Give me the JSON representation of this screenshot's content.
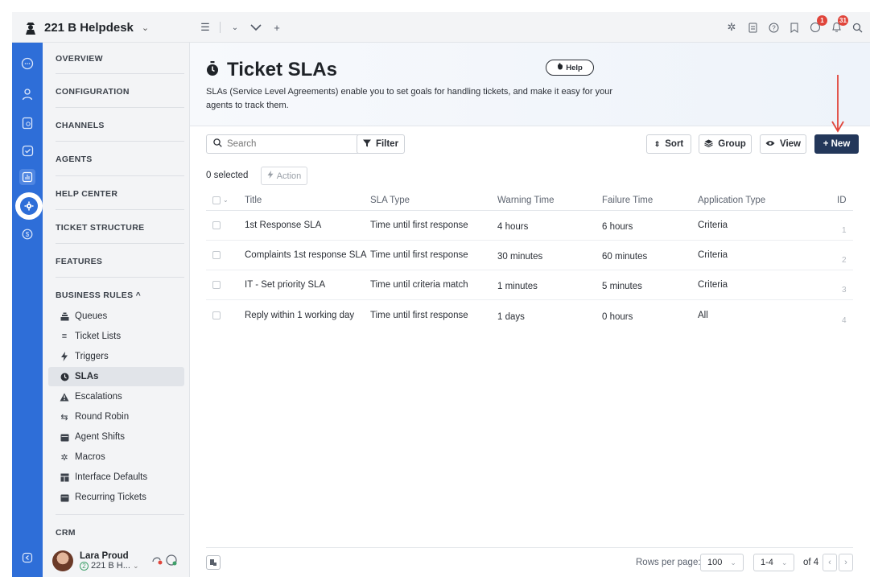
{
  "topbar": {
    "brand_name": "221 B Helpdesk",
    "badges": {
      "notifications_1": "1",
      "notifications_2": "31"
    }
  },
  "sidebar": {
    "sections": [
      "OVERVIEW",
      "CONFIGURATION",
      "CHANNELS",
      "AGENTS",
      "HELP CENTER",
      "TICKET STRUCTURE",
      "FEATURES"
    ],
    "business_rules_label": "BUSINESS RULES ^",
    "business_rules_items": [
      {
        "label": "Queues",
        "icon": "queues-icon"
      },
      {
        "label": "Ticket Lists",
        "icon": "list-icon"
      },
      {
        "label": "Triggers",
        "icon": "bolt-icon"
      },
      {
        "label": "SLAs",
        "icon": "clock-icon"
      },
      {
        "label": "Escalations",
        "icon": "warning-icon"
      },
      {
        "label": "Round Robin",
        "icon": "round-robin-icon"
      },
      {
        "label": "Agent Shifts",
        "icon": "calendar-icon"
      },
      {
        "label": "Macros",
        "icon": "sparkle-icon"
      },
      {
        "label": "Interface Defaults",
        "icon": "interface-icon"
      },
      {
        "label": "Recurring Tickets",
        "icon": "calendar-icon"
      }
    ],
    "crm_label": "CRM",
    "user": {
      "name": "Lara Proud",
      "org_count": "2",
      "org": "221 B H..."
    }
  },
  "page": {
    "title": "Ticket SLAs",
    "help_label": "Help",
    "description": "SLAs (Service Level Agreements) enable you to set goals for handling tickets, and make it easy for your agents to track them."
  },
  "toolbar": {
    "search_placeholder": "Search",
    "filter_label": "Filter",
    "sort_label": "Sort",
    "group_label": "Group",
    "view_label": "View",
    "new_label": "+ New",
    "selected_label": "0 selected",
    "action_label": "Action"
  },
  "table": {
    "columns": [
      "Title",
      "SLA Type",
      "Warning Time",
      "Failure Time",
      "Application Type",
      "ID"
    ],
    "rows": [
      {
        "title": "1st Response SLA",
        "sla_type": "Time until first response",
        "warning": "4 hours",
        "failure": "6 hours",
        "app_type": "Criteria",
        "id": "1"
      },
      {
        "title": "Complaints 1st response SLA",
        "sla_type": "Time until first response",
        "warning": "30 minutes",
        "failure": "60 minutes",
        "app_type": "Criteria",
        "id": "2"
      },
      {
        "title": "IT - Set priority SLA",
        "sla_type": "Time until criteria match",
        "warning": "1 minutes",
        "failure": "5 minutes",
        "app_type": "Criteria",
        "id": "3"
      },
      {
        "title": "Reply within 1 working day",
        "sla_type": "Time until first response",
        "warning": "1 days",
        "failure": "0 hours",
        "app_type": "All",
        "id": "4"
      }
    ]
  },
  "footer": {
    "rows_per_page_label": "Rows per page:",
    "rows_per_page_value": "100",
    "range_value": "1-4",
    "of_label": "of 4"
  },
  "colors": {
    "rail": "#2e6ed8",
    "new_button": "#23375a",
    "annotation_arrow": "#e0453b"
  }
}
